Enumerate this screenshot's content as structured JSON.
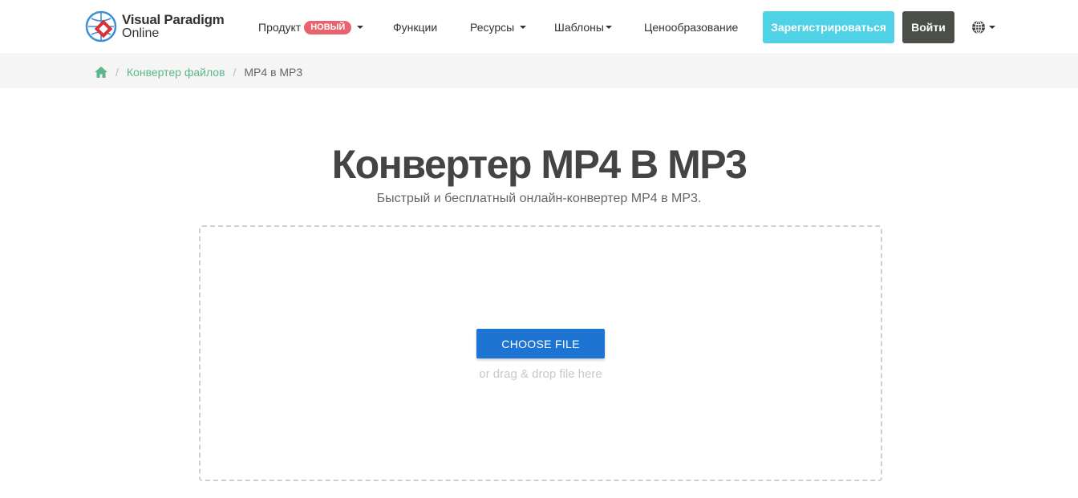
{
  "header": {
    "logo": {
      "line1": "Visual Paradigm",
      "line2": "Online"
    },
    "nav": {
      "product": {
        "label": "Продукт",
        "badge": "НОВЫЙ"
      },
      "features": "Функции",
      "resources": "Ресурсы",
      "templates": "Шаблоны",
      "pricing": "Ценообразование"
    },
    "register_label": "Зарегистрироваться",
    "login_label": "Войти"
  },
  "breadcrumb": {
    "home_icon": "home-icon",
    "items": [
      "Конвертер файлов",
      "MP4 в MP3"
    ]
  },
  "main": {
    "title": "Конвертер MP4 В MP3",
    "subtitle": "Быстрый и бесплатный онлайн-конвертер MP4 в MP3.",
    "choose_label": "CHOOSE FILE",
    "drop_hint": "or drag & drop file here"
  },
  "colors": {
    "register": "#4fd1e6",
    "login": "#4a5048",
    "badge": "#e8636d",
    "breadcrumb_link": "#5cb88a",
    "choose_button": "#1e74d2"
  }
}
